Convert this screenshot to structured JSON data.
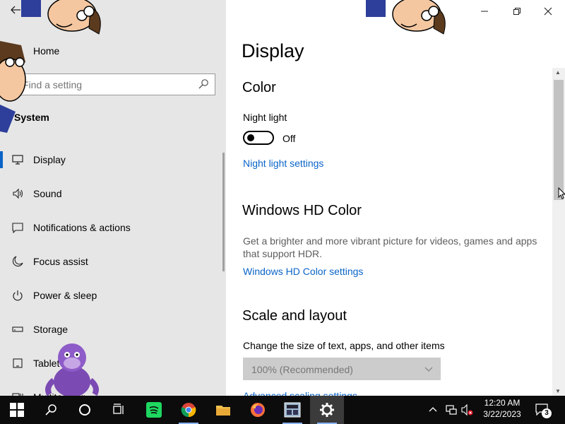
{
  "sidebar": {
    "home_label": "Home",
    "search_placeholder": "Find a setting",
    "search_value": "",
    "section_title": "System",
    "items": [
      {
        "label": "Display",
        "icon": "monitor-icon",
        "active": true
      },
      {
        "label": "Sound",
        "icon": "speaker-icon",
        "active": false
      },
      {
        "label": "Notifications & actions",
        "icon": "chat-icon",
        "active": false
      },
      {
        "label": "Focus assist",
        "icon": "moon-icon",
        "active": false
      },
      {
        "label": "Power & sleep",
        "icon": "power-icon",
        "active": false
      },
      {
        "label": "Storage",
        "icon": "drive-icon",
        "active": false
      },
      {
        "label": "Tablet",
        "icon": "tablet-icon",
        "active": false
      },
      {
        "label": "Multitasking",
        "icon": "multitask-icon",
        "active": false
      }
    ]
  },
  "main": {
    "title": "Display",
    "color": {
      "heading": "Color",
      "night_light_label": "Night light",
      "night_light_state": "Off",
      "night_light_on": false,
      "night_light_link": "Night light settings"
    },
    "hd_color": {
      "heading": "Windows HD Color",
      "description": "Get a brighter and more vibrant picture for videos, games and apps that support HDR.",
      "link": "Windows HD Color settings"
    },
    "scale": {
      "heading": "Scale and layout",
      "label": "Change the size of text, apps, and other items",
      "selected": "100% (Recommended)",
      "link": "Advanced scaling settings"
    }
  },
  "window_controls": [
    "minimize-icon",
    "restore-icon",
    "close-icon"
  ],
  "taskbar": {
    "apps": [
      "windows-start-icon",
      "search-icon",
      "cortana-icon",
      "task-view-icon",
      "spotify-icon",
      "chrome-icon",
      "file-explorer-icon",
      "firefox-icon",
      "calculator-app-icon",
      "settings-icon"
    ],
    "time": "12:20 AM",
    "date": "3/22/2023",
    "notification_count": "3"
  },
  "colors": {
    "accent": "#0a64c8",
    "sidebar_bg": "#e6e6e6",
    "taskbar_bg": "#0c0c0c"
  }
}
